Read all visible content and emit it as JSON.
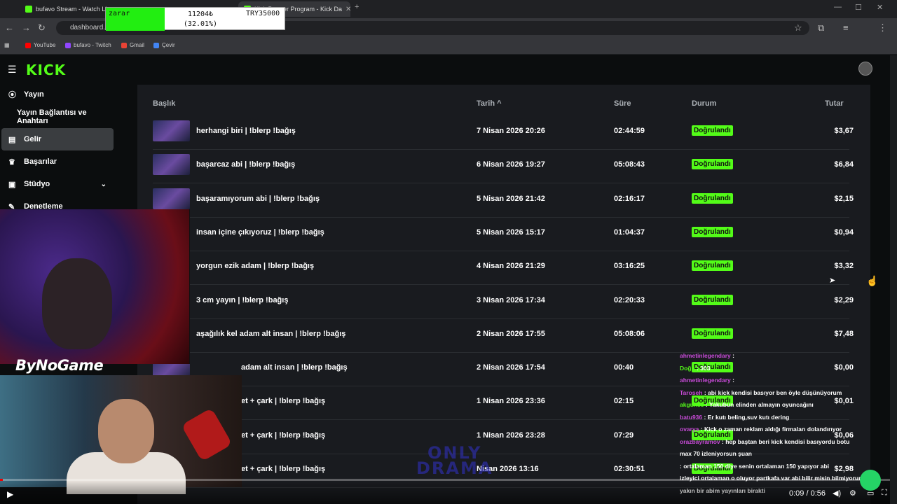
{
  "browser": {
    "tabs": [
      {
        "title": "bufavo Stream - Watch Live o",
        "active": false
      },
      {
        "title": "",
        "active": false
      },
      {
        "title": "Kick Partner Program - Kick Da",
        "active": true
      }
    ],
    "url": "dashboard.k",
    "bookmarks": [
      {
        "label": "YouTube",
        "color": "#ff0000"
      },
      {
        "label": "bufavo - Twitch",
        "color": "#9146ff"
      },
      {
        "label": "Gmail",
        "color": "#ea4335"
      },
      {
        "label": "Çevir",
        "color": "#4285f4"
      }
    ]
  },
  "overlay_stats": {
    "label": "zarar",
    "value": "11204₺",
    "percent": "(32.01%)",
    "target": "TRY35000"
  },
  "app": {
    "logo": "KICK",
    "nav": [
      {
        "label": "Yayın",
        "icon": "broadcast-icon",
        "active": false
      },
      {
        "label": "Yayın Bağlantısı ve Anahtarı",
        "icon": "",
        "active": false
      },
      {
        "label": "Gelir",
        "icon": "chart-icon",
        "active": true
      },
      {
        "label": "Başarılar",
        "icon": "trophy-icon",
        "active": false
      },
      {
        "label": "Stüdyo",
        "icon": "studio-icon",
        "active": false
      },
      {
        "label": "Denetleme",
        "icon": "wrench-icon",
        "active": false
      }
    ],
    "table": {
      "headers": {
        "title": "Başlık",
        "date": "Tarih ^",
        "duration": "Süre",
        "status": "Durum",
        "amount": "Tutar"
      },
      "rows": [
        {
          "title": "herhangi biri | !blerp !bağış",
          "date": "7 Nisan 2026 20:26",
          "duration": "02:44:59",
          "status": "Doğrulandı",
          "amount": "$3,67"
        },
        {
          "title": "başarcaz abi | !blerp !bağış",
          "date": "6 Nisan 2026 19:27",
          "duration": "05:08:43",
          "status": "Doğrulandı",
          "amount": "$6,84"
        },
        {
          "title": "başaramıyorum abi | !blerp !bağış",
          "date": "5 Nisan 2026 21:42",
          "duration": "02:16:17",
          "status": "Doğrulandı",
          "amount": "$2,15"
        },
        {
          "title": "insan içine çıkıyoruz | !blerp !bağış",
          "date": "5 Nisan 2026 15:17",
          "duration": "01:04:37",
          "status": "Doğrulandı",
          "amount": "$0,94"
        },
        {
          "title": "yorgun ezik adam | !blerp !bağış",
          "date": "4 Nisan 2026 21:29",
          "duration": "03:16:25",
          "status": "Doğrulandı",
          "amount": "$3,32"
        },
        {
          "title": "3 cm yayın | !blerp !bağış",
          "date": "3 Nisan 2026 17:34",
          "duration": "02:20:33",
          "status": "Doğrulandı",
          "amount": "$2,29"
        },
        {
          "title": "aşağılık kel adam alt insan | !blerp !bağış",
          "date": "2 Nisan 2026 17:55",
          "duration": "05:08:06",
          "status": "Doğrulandı",
          "amount": "$7,48"
        },
        {
          "title": "adam alt insan | !blerp !bağış",
          "date": "2 Nisan 2026 17:54",
          "duration": "00:40",
          "status": "Doğrulandı",
          "amount": "$0,00"
        },
        {
          "title": "et + çark | !blerp !bağış",
          "date": "1 Nisan 2026 23:36",
          "duration": "02:15",
          "status": "Doğrulandı",
          "amount": "$0,01"
        },
        {
          "title": "et + çark | !blerp !bağış",
          "date": "1 Nisan 2026 23:28",
          "duration": "07:29",
          "status": "Doğrulandı",
          "amount": "$0,06"
        },
        {
          "title": "et + çark | !blerp !bağış",
          "date": "Nisan 2026 13:16",
          "duration": "02:30:51",
          "status": "Doğrulandı",
          "amount": "$2,98"
        }
      ]
    }
  },
  "webcam": {
    "label": "ByNoGame"
  },
  "watermark": "ONLY\nDRAMA",
  "chat": [
    {
      "user": "ahmetinlegendary",
      "text": ":",
      "color": "#c84bd8"
    },
    {
      "user": "Doğu",
      "text": ": 303",
      "color": "#53fc18"
    },
    {
      "user": "ahmetinlegendary",
      "text": ":",
      "color": "#c84bd8"
    },
    {
      "user": "Taroseh",
      "text": ": abi kick kendisi basıyor ben öyle düşünüyorum",
      "color": "#c84bd8"
    },
    {
      "user": "akgun55",
      "text": ": Yakubun elinden almayın oyuncağını",
      "color": "#53fc18"
    },
    {
      "user": "batu936",
      "text": ": Er kutı beling,suv kutı dering",
      "color": "#c84bd8"
    },
    {
      "user": "ovarya",
      "text": ": Kick o zaman reklam aldığı firmaları dolandırıyor",
      "color": "#c84bd8"
    },
    {
      "user": "orazbayramov",
      "text": ": hep baştan beri kick kendisi basıyordu botu",
      "color": "#c84bd8"
    },
    {
      "user": "",
      "text": "max 70 izleniyorsun şuan",
      "color": "#c84bd8"
    },
    {
      "user": "",
      "text": ": ortalaman 150 diye senin ortalaman 150 yapıyor abi",
      "color": "#c84bd8"
    },
    {
      "user": "",
      "text": "izleyici ortalaman o oluyor partkafa var abi bilir misin bilmiyorum",
      "color": "#c84bd8"
    },
    {
      "user": "",
      "text": "yakın bir abim yayınları birakti",
      "color": "#c84bd8"
    }
  ],
  "player": {
    "time": "0:09 / 0:56",
    "progress": 0.003
  }
}
